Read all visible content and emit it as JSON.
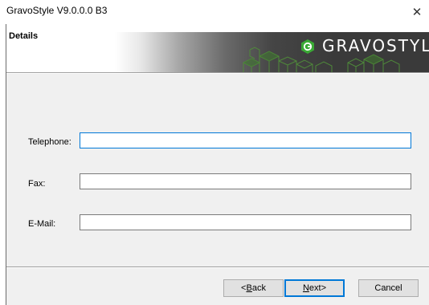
{
  "window": {
    "title": "GravoStyle V9.0.0.0 B3",
    "close_glyph": "✕"
  },
  "header": {
    "title": "Details",
    "logo_text": "GRAVOSTYLE",
    "logo_icon": "gravostyle-logo-icon"
  },
  "form": {
    "telephone": {
      "label": "Telephone:",
      "value": ""
    },
    "fax": {
      "label": "Fax:",
      "value": ""
    },
    "email": {
      "label": "E-Mail:",
      "value": ""
    }
  },
  "buttons": {
    "back": {
      "prefix": "< ",
      "mnemonic": "B",
      "rest": "ack"
    },
    "next": {
      "mnemonic": "N",
      "rest": "ext",
      "suffix": " >"
    },
    "cancel": {
      "label": "Cancel"
    }
  },
  "colors": {
    "accent": "#0078d7",
    "logo_green": "#3aaa35",
    "banner_dark": "#3a3a3a"
  }
}
